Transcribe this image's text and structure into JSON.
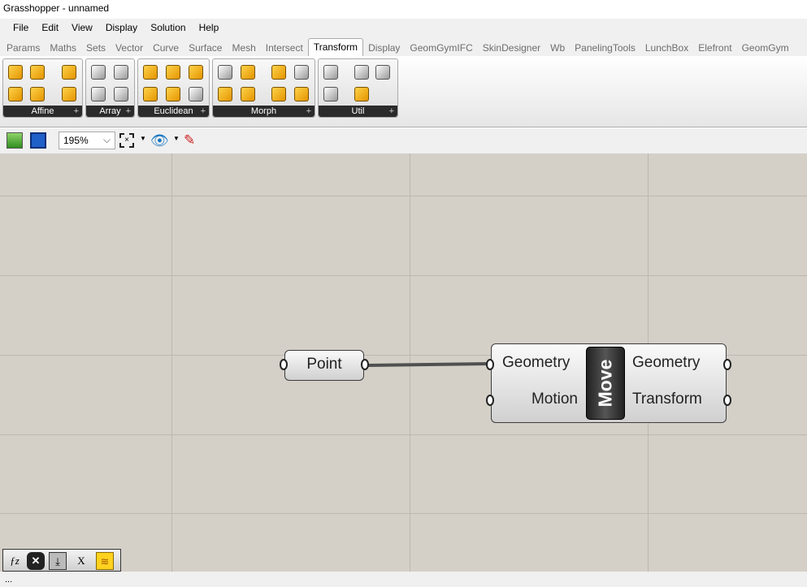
{
  "window": {
    "title": "Grasshopper - unnamed"
  },
  "menu": [
    "File",
    "Edit",
    "View",
    "Display",
    "Solution",
    "Help"
  ],
  "tabs": [
    "Params",
    "Maths",
    "Sets",
    "Vector",
    "Curve",
    "Surface",
    "Mesh",
    "Intersect",
    "Transform",
    "Display",
    "GeomGymIFC",
    "SkinDesigner",
    "Wb",
    "PanelingTools",
    "LunchBox",
    "Elefront",
    "GeomGym"
  ],
  "active_tab": "Transform",
  "ribbon_groups": [
    "Affine",
    "Array",
    "Euclidean",
    "Morph",
    "Util"
  ],
  "toolbar": {
    "zoom": "195%"
  },
  "canvas": {
    "point": {
      "label": "Point"
    },
    "move": {
      "name": "Move",
      "inputs": [
        "Geometry",
        "Motion"
      ],
      "outputs": [
        "Geometry",
        "Transform"
      ]
    }
  },
  "status": "..."
}
